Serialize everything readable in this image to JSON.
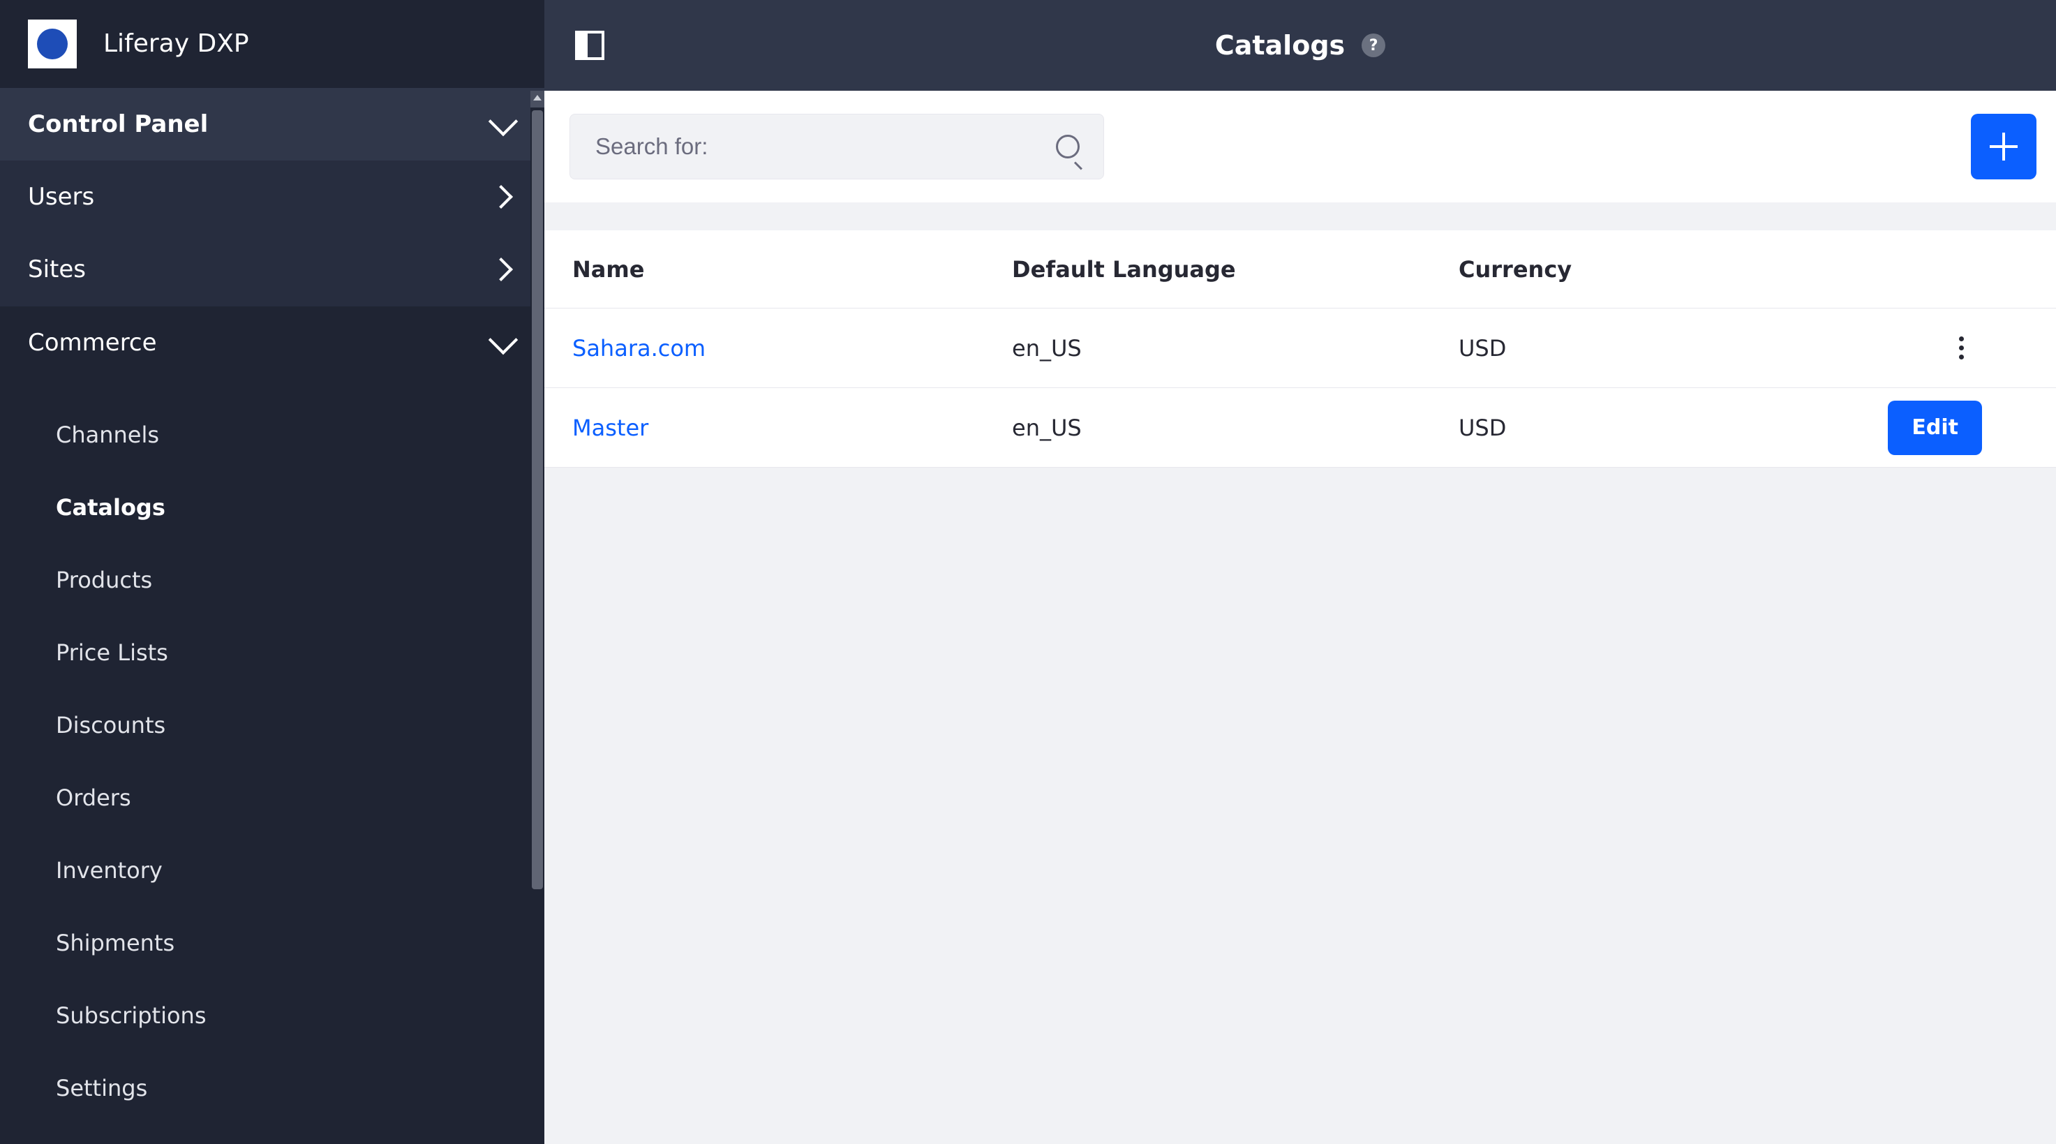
{
  "brand": {
    "title": "Liferay DXP"
  },
  "sidebar": {
    "sections": [
      {
        "label": "Control Panel",
        "expanded": true
      },
      {
        "label": "Users"
      },
      {
        "label": "Sites"
      },
      {
        "label": "Commerce",
        "expanded": true
      }
    ],
    "commerce_items": [
      {
        "label": "Channels"
      },
      {
        "label": "Catalogs",
        "active": true
      },
      {
        "label": "Products"
      },
      {
        "label": "Price Lists"
      },
      {
        "label": "Discounts"
      },
      {
        "label": "Orders"
      },
      {
        "label": "Inventory"
      },
      {
        "label": "Shipments"
      },
      {
        "label": "Subscriptions"
      },
      {
        "label": "Settings"
      }
    ]
  },
  "page": {
    "title": "Catalogs",
    "help_symbol": "?"
  },
  "search": {
    "placeholder": "Search for:"
  },
  "actions": {
    "edit_label": "Edit"
  },
  "table": {
    "headers": {
      "name": "Name",
      "language": "Default Language",
      "currency": "Currency"
    },
    "rows": [
      {
        "name": "Sahara.com",
        "language": "en_US",
        "currency": "USD",
        "action": "menu"
      },
      {
        "name": "Master",
        "language": "en_US",
        "currency": "USD",
        "action": "edit"
      }
    ]
  }
}
